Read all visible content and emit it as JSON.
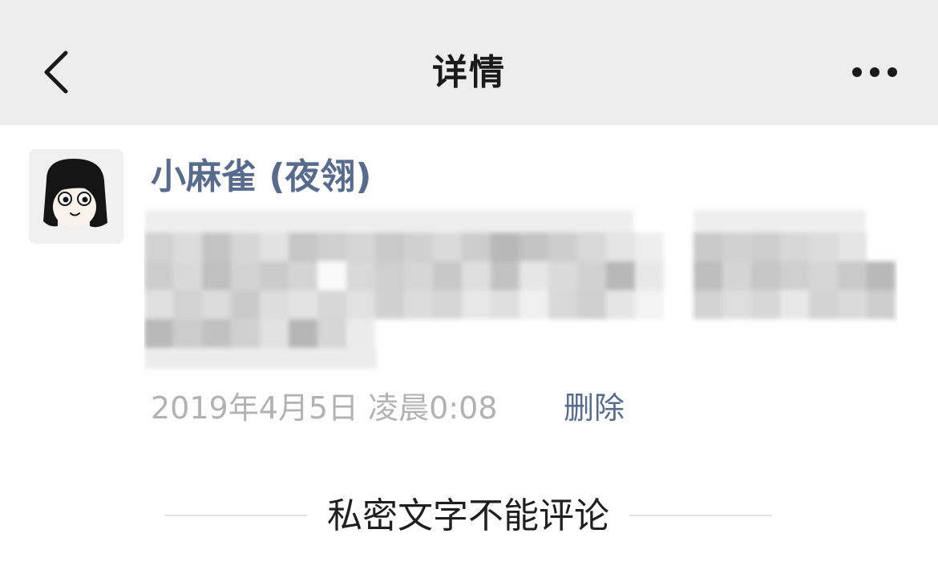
{
  "navbar": {
    "title": "详情",
    "back_icon": "chevron-left-icon",
    "more_icon": "more-horizontal-icon",
    "background": "#ededed"
  },
  "post": {
    "username": "小麻雀 (夜翎)",
    "timestamp": "2019年4月5日 凌晨0:08",
    "delete_label": "删除",
    "content_pixelated": true,
    "accent_color": "#586b8c"
  },
  "comments": {
    "notice": "私密文字不能评论"
  }
}
